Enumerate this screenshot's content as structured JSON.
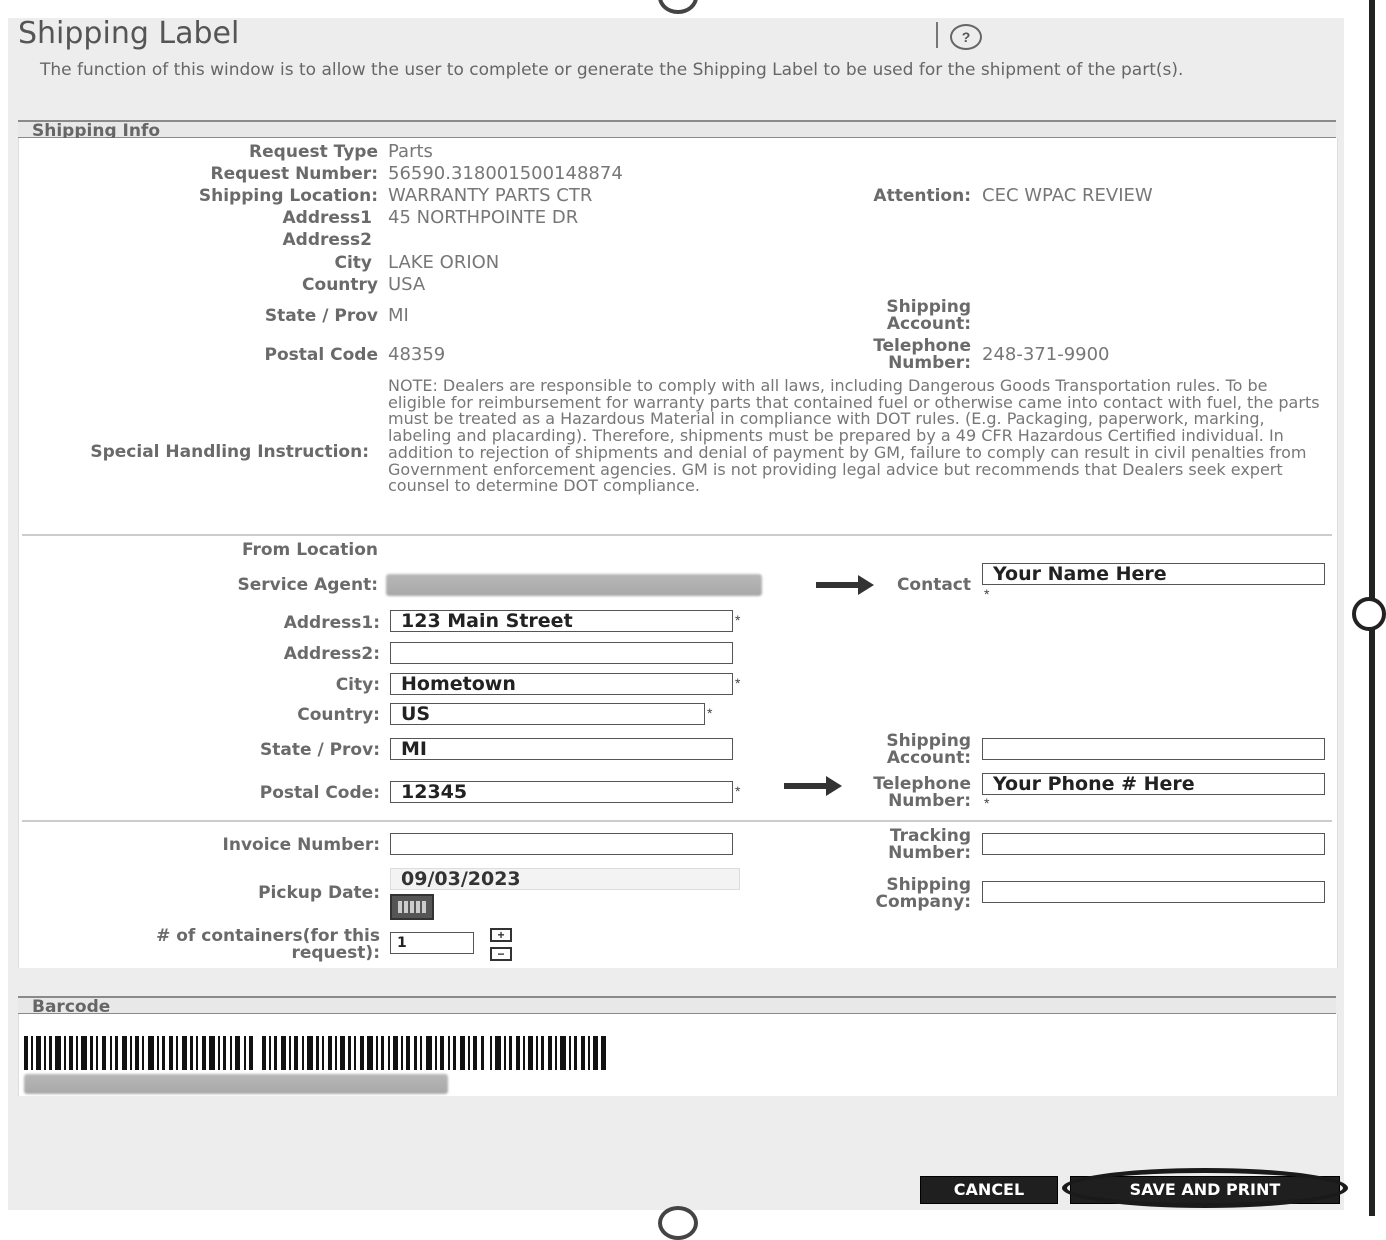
{
  "header": {
    "title": "Shipping Label",
    "help_icon": "question-circle-icon",
    "description": "The function of this window is to allow the user to complete or generate the Shipping Label to be used for the shipment of the part(s)."
  },
  "shipping_info": {
    "section_title": "Shipping Info",
    "request_type_label": "Request Type",
    "request_type": "Parts",
    "request_number_label": "Request Number:",
    "request_number": "56590.318001500148874",
    "shipping_location_label": "Shipping Location:",
    "shipping_location": "WARRANTY PARTS CTR",
    "attention_label": "Attention:",
    "attention": "CEC WPAC REVIEW",
    "address1_label": "Address1",
    "address1": "45 NORTHPOINTE DR",
    "address2_label": "Address2",
    "city_label": "City",
    "city": "LAKE ORION",
    "country_label": "Country",
    "country": "USA",
    "state_label": "State / Prov",
    "state": "MI",
    "shipping_account_label_1": "Shipping",
    "shipping_account_label_2": "Account:",
    "postal_code_label": "Postal Code",
    "postal_code": "48359",
    "telephone_label_1": "Telephone",
    "telephone_label_2": "Number:",
    "telephone": "248-371-9900",
    "special_handling_label": "Special Handling Instruction:",
    "special_handling": "NOTE: Dealers are responsible to comply with all laws, including Dangerous Goods Transportation rules. To be eligible for reimbursement for warranty parts that contained fuel or otherwise came into contact with fuel, the parts must be treated as a Hazardous Material in compliance with DOT rules. (E.g. Packaging, paperwork, marking, labeling and placarding). Therefore, shipments must be prepared by a 49 CFR Hazardous Certified individual. In addition to rejection of shipments and denial of payment by GM, failure to comply can result in civil penalties from Government enforcement agencies. GM is not providing legal advice but recommends that Dealers seek expert counsel to determine DOT compliance."
  },
  "from_location": {
    "heading": "From Location",
    "service_agent_label": "Service Agent:",
    "contact_label": "Contact",
    "contact_value": "Your Name Here",
    "address1_label": "Address1:",
    "address1_value": "123 Main Street",
    "address2_label": "Address2:",
    "address2_value": "",
    "city_label": "City:",
    "city_value": "Hometown",
    "country_label": "Country:",
    "country_value": "US",
    "state_label": "State / Prov:",
    "state_value": "MI",
    "shipping_account_label_1": "Shipping",
    "shipping_account_label_2": "Account:",
    "shipping_account_value": "",
    "postal_code_label": "Postal Code:",
    "postal_code_value": "12345",
    "telephone_label_1": "Telephone",
    "telephone_label_2": "Number:",
    "telephone_value": "Your Phone # Here",
    "required_marker": "*"
  },
  "shipment": {
    "invoice_label": "Invoice Number:",
    "invoice_value": "",
    "tracking_label_1": "Tracking",
    "tracking_label_2": "Number:",
    "tracking_value": "",
    "pickup_label": "Pickup Date:",
    "pickup_value": "09/03/2023",
    "calendar_icon": "calendar-icon",
    "shipping_company_label_1": "Shipping",
    "shipping_company_label_2": "Company:",
    "shipping_company_value": "",
    "containers_label_1": "# of containers(for this",
    "containers_label_2": "request):",
    "containers_value": "1",
    "increment_icon": "plus-icon",
    "decrement_icon": "minus-icon"
  },
  "barcode": {
    "section_title": "Barcode"
  },
  "footer": {
    "cancel_label": "CANCEL",
    "save_print_label": "SAVE AND PRINT"
  }
}
